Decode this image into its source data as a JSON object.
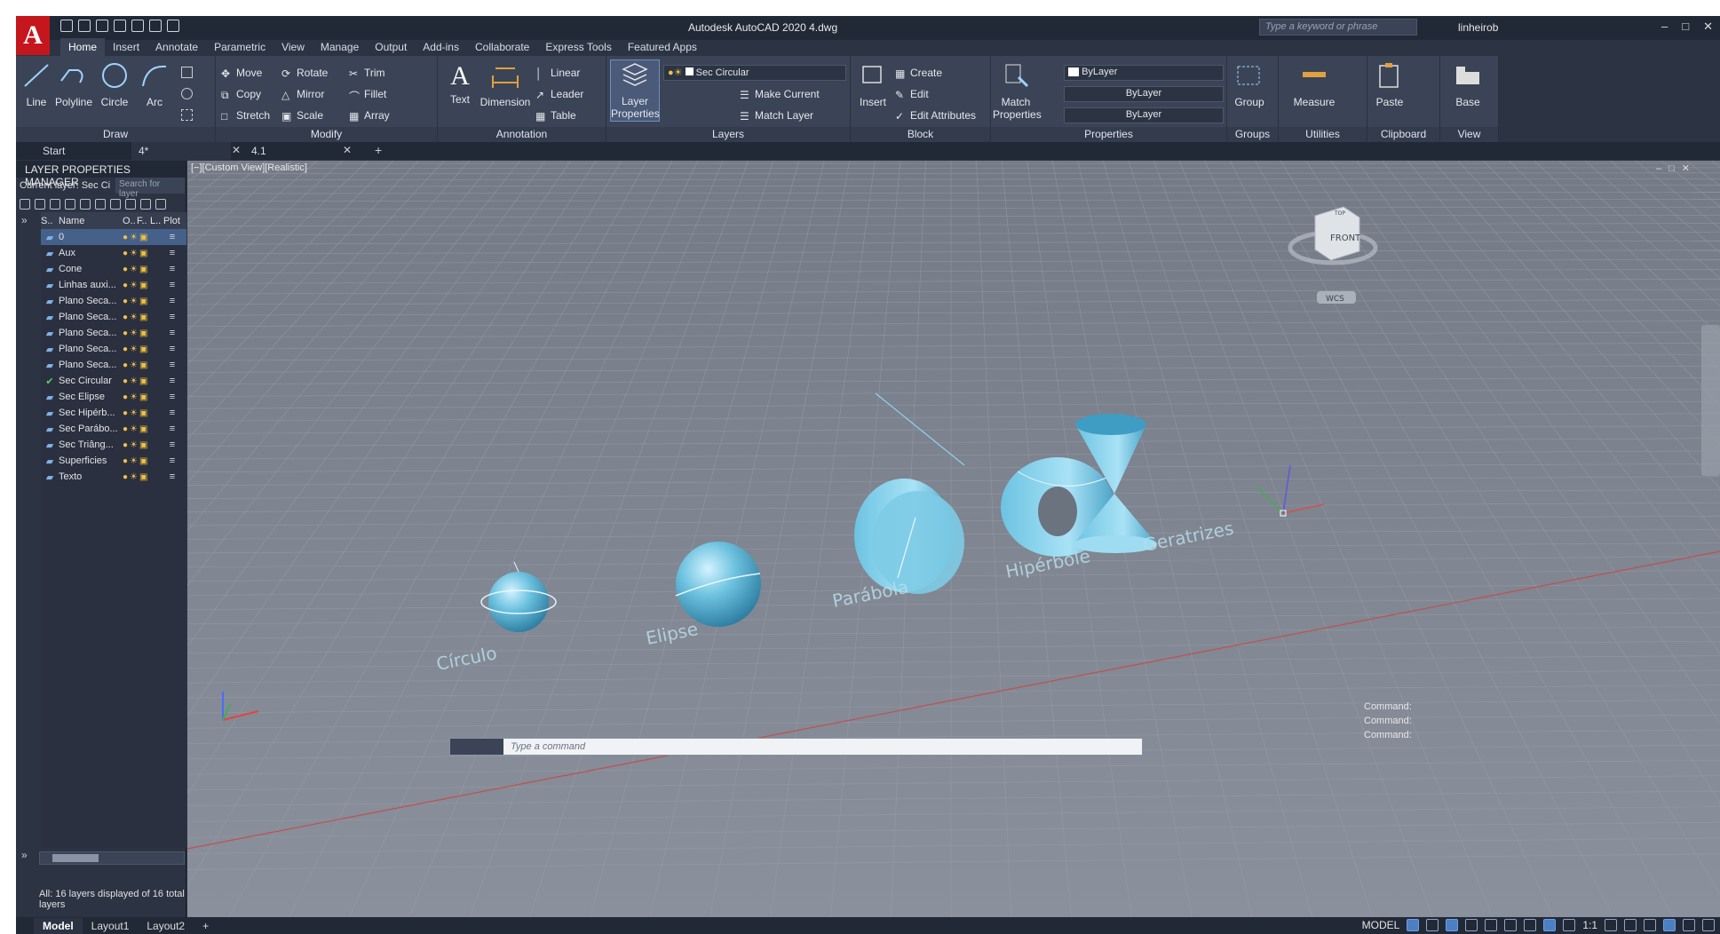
{
  "app": {
    "title": "Autodesk AutoCAD 2020   4.dwg",
    "logo": "A",
    "search_placeholder": "Type a keyword or phrase",
    "user": "linheirob"
  },
  "ribbon_tabs": [
    "Home",
    "Insert",
    "Annotate",
    "Parametric",
    "View",
    "Manage",
    "Output",
    "Add-ins",
    "Collaborate",
    "Express Tools",
    "Featured Apps"
  ],
  "ribbon": {
    "draw": {
      "title": "Draw",
      "line": "Line",
      "polyline": "Polyline",
      "circle": "Circle",
      "arc": "Arc"
    },
    "modify": {
      "title": "Modify",
      "move": "Move",
      "rotate": "Rotate",
      "trim": "Trim",
      "copy": "Copy",
      "mirror": "Mirror",
      "fillet": "Fillet",
      "stretch": "Stretch",
      "scale": "Scale",
      "array": "Array"
    },
    "annotation": {
      "title": "Annotation",
      "text": "Text",
      "dimension": "Dimension",
      "linear": "Linear",
      "leader": "Leader",
      "table": "Table"
    },
    "layers": {
      "title": "Layers",
      "layer_properties": "Layer Properties",
      "current_layer": "Sec Circular",
      "make_current": "Make Current",
      "match_layer": "Match Layer"
    },
    "block": {
      "title": "Block",
      "insert": "Insert",
      "create": "Create",
      "edit": "Edit",
      "edit_attributes": "Edit Attributes"
    },
    "properties": {
      "title": "Properties",
      "match_properties": "Match Properties",
      "color": "ByLayer",
      "linetype": "ByLayer",
      "lineweight": "ByLayer"
    },
    "groups": {
      "title": "Groups",
      "group": "Group"
    },
    "utilities": {
      "title": "Utilities",
      "measure": "Measure"
    },
    "clipboard": {
      "title": "Clipboard",
      "paste": "Paste"
    },
    "view": {
      "title": "View",
      "base": "Base"
    }
  },
  "doc_tabs": [
    "Start",
    "4*",
    "4.1"
  ],
  "layer_manager": {
    "title": "LAYER PROPERTIES MANAGER",
    "current_layer": "Current layer: Sec Ci",
    "search_placeholder": "Search for layer",
    "columns": [
      "S..",
      "Name",
      "O..",
      "F..",
      "L..",
      "Plot"
    ],
    "layers": [
      "0",
      "Aux",
      "Cone",
      "Linhas auxi...",
      "Plano Seca...",
      "Plano Seca...",
      "Plano Seca...",
      "Plano Seca...",
      "Plano Seca...",
      "Sec Circular",
      "Sec Elipse",
      "Sec Hipérb...",
      "Sec Parábo...",
      "Sec Triâng...",
      "Superficies",
      "Texto"
    ],
    "status": "All: 16 layers displayed of 16 total layers"
  },
  "viewport": {
    "label": "[−][Custom View][Realistic]",
    "labels_3d": [
      "Círculo",
      "Elipse",
      "Parábola",
      "Hipérbole",
      "Geratrizes"
    ],
    "viewcube": {
      "face": "FRONT",
      "top": "TOP",
      "wcs": "WCS"
    }
  },
  "command": {
    "history": [
      "Command:",
      "Command:",
      "Command:"
    ],
    "placeholder": "Type a command"
  },
  "layout_tabs": [
    "Model",
    "Layout1",
    "Layout2"
  ],
  "status": {
    "model": "MODEL",
    "scale": "1:1"
  }
}
